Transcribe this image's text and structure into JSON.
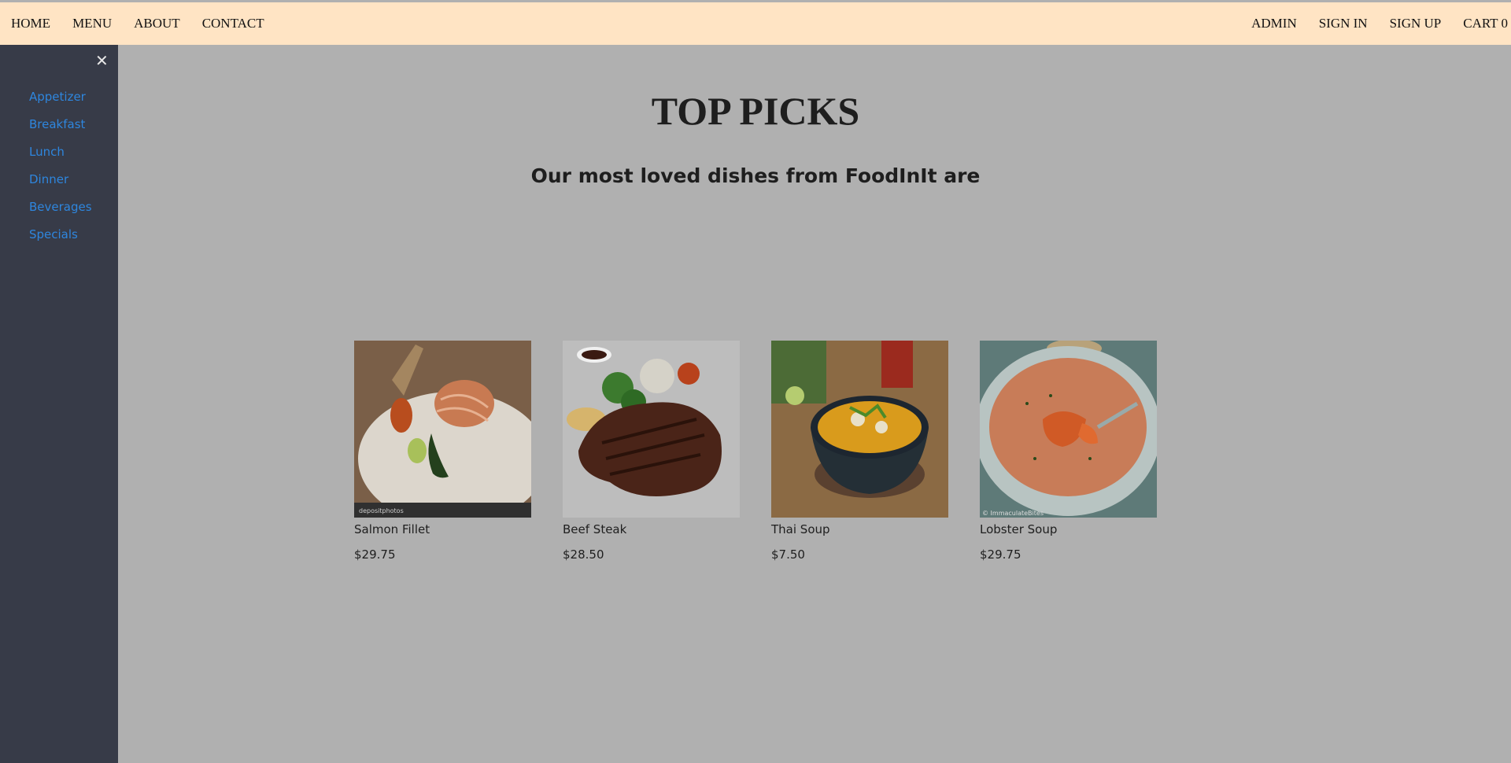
{
  "nav": {
    "left": [
      "HOME",
      "MENU",
      "ABOUT",
      "CONTACT"
    ],
    "right": [
      "ADMIN",
      "SIGN IN",
      "SIGN UP",
      "CART 0"
    ]
  },
  "sidebar": {
    "close_icon": "close-icon",
    "items": [
      "Appetizer",
      "Breakfast",
      "Lunch",
      "Dinner",
      "Beverages",
      "Specials"
    ]
  },
  "main": {
    "title": "TOP PICKS",
    "subtitle": "Our most loved dishes from FoodInIt are"
  },
  "dishes": [
    {
      "name": "Salmon Fillet",
      "price": "$29.75"
    },
    {
      "name": "Beef Steak",
      "price": "$28.50"
    },
    {
      "name": "Thai Soup",
      "price": "$7.50"
    },
    {
      "name": "Lobster Soup",
      "price": "$29.75"
    }
  ],
  "colors": {
    "nav_bg": "#ffe4c4",
    "sidebar_bg": "#373b48",
    "link": "#2e86de",
    "overlay_bg": "#b0b0b0"
  }
}
